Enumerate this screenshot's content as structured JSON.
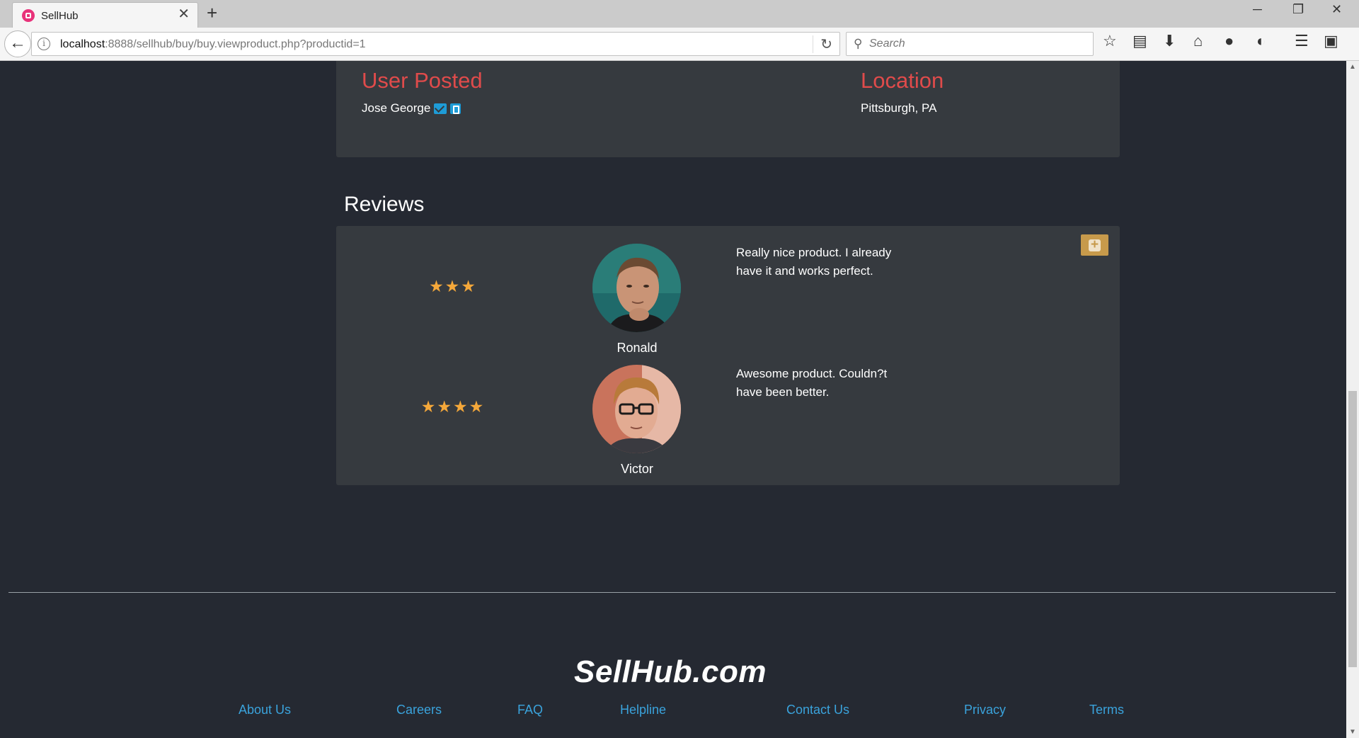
{
  "browser": {
    "tab_title": "SellHub",
    "new_tab_symbol": "+",
    "url_host": "localhost",
    "url_rest": ":8888/sellhub/buy/buy.viewproduct.php?productid=1",
    "search_placeholder": "Search"
  },
  "listing": {
    "user_heading": "User Posted",
    "user_name": "Jose George",
    "location_heading": "Location",
    "location_value": "Pittsburgh, PA"
  },
  "reviews": {
    "title": "Reviews",
    "items": [
      {
        "stars": "★★★",
        "rating": 3,
        "name": "Ronald",
        "text": "Really nice product. I already have it and works perfect."
      },
      {
        "stars": "★★★★",
        "rating": 4,
        "name": "Victor",
        "text": "Awesome product. Couldn?t have been better."
      }
    ]
  },
  "footer": {
    "logo": "SellHub.com",
    "links": [
      "About Us",
      "Careers",
      "FAQ",
      "Helpline",
      "Contact Us",
      "Privacy",
      "Terms"
    ]
  },
  "colors": {
    "page_bg": "#252932",
    "panel_bg": "#363a3f",
    "heading_red": "#e04b4b",
    "link_blue": "#3aa3dc",
    "star_orange": "#f5a83a",
    "button_gold": "#c79a4b"
  }
}
